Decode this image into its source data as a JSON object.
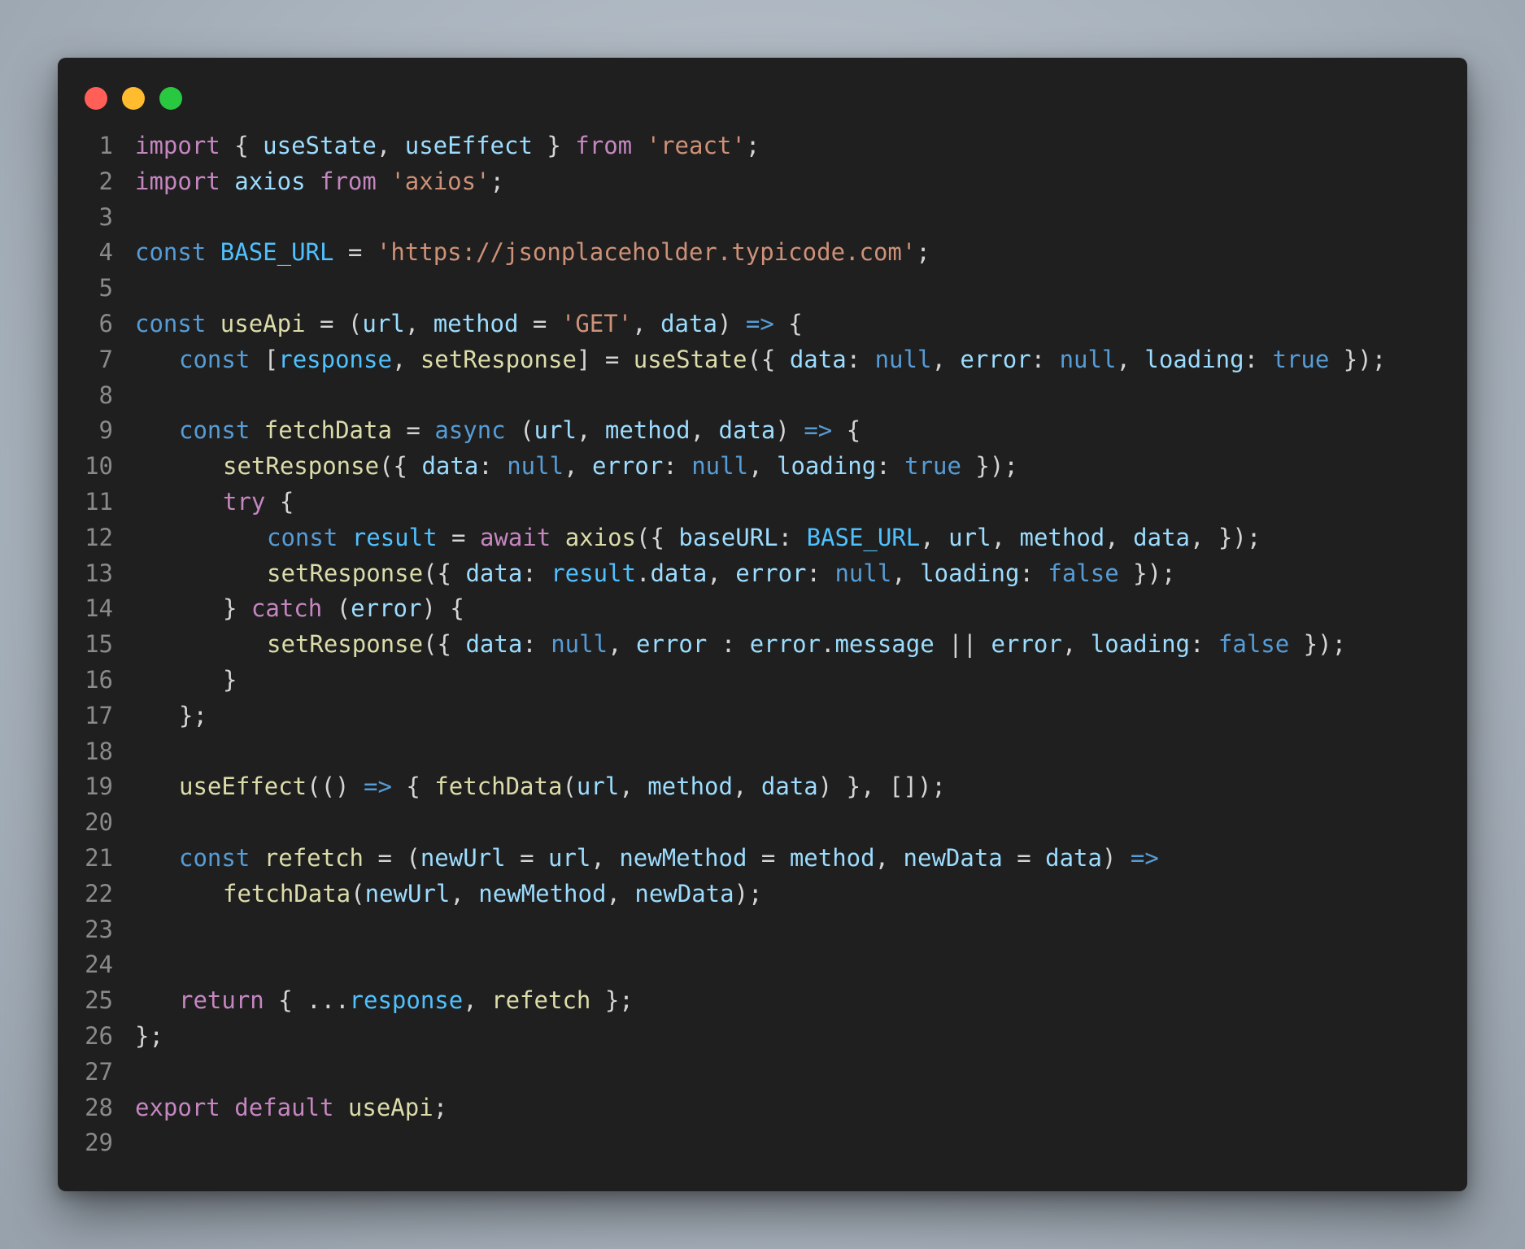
{
  "window": {
    "buttons": {
      "close": "#ff5f57",
      "minimize": "#febc2e",
      "zoom": "#28c840"
    }
  },
  "theme": {
    "background": "#1f1f1f",
    "line_number": "#8a8a8a",
    "colors": {
      "k": "#c586c0",
      "s": "#ce9178",
      "d": "#569cd6",
      "f": "#dcdcaa",
      "v": "#9cdcfe",
      "c": "#4fc1ff",
      "p": "#d4d4d4"
    }
  },
  "code": {
    "language": "javascript",
    "lines": [
      {
        "n": "1",
        "indent": 0,
        "tokens": [
          [
            "k",
            "import"
          ],
          [
            "p",
            " { "
          ],
          [
            "v",
            "useState"
          ],
          [
            "p",
            ", "
          ],
          [
            "v",
            "useEffect"
          ],
          [
            "p",
            " } "
          ],
          [
            "k",
            "from"
          ],
          [
            "p",
            " "
          ],
          [
            "s",
            "'react'"
          ],
          [
            "p",
            ";"
          ]
        ]
      },
      {
        "n": "2",
        "indent": 0,
        "tokens": [
          [
            "k",
            "import"
          ],
          [
            "p",
            " "
          ],
          [
            "v",
            "axios"
          ],
          [
            "p",
            " "
          ],
          [
            "k",
            "from"
          ],
          [
            "p",
            " "
          ],
          [
            "s",
            "'axios'"
          ],
          [
            "p",
            ";"
          ]
        ]
      },
      {
        "n": "3",
        "indent": 0,
        "tokens": []
      },
      {
        "n": "4",
        "indent": 0,
        "tokens": [
          [
            "d",
            "const"
          ],
          [
            "p",
            " "
          ],
          [
            "c",
            "BASE_URL"
          ],
          [
            "p",
            " = "
          ],
          [
            "s",
            "'https://jsonplaceholder.typicode.com'"
          ],
          [
            "p",
            ";"
          ]
        ]
      },
      {
        "n": "5",
        "indent": 0,
        "tokens": []
      },
      {
        "n": "6",
        "indent": 0,
        "tokens": [
          [
            "d",
            "const"
          ],
          [
            "p",
            " "
          ],
          [
            "f",
            "useApi"
          ],
          [
            "p",
            " = ("
          ],
          [
            "v",
            "url"
          ],
          [
            "p",
            ", "
          ],
          [
            "v",
            "method"
          ],
          [
            "p",
            " = "
          ],
          [
            "s",
            "'GET'"
          ],
          [
            "p",
            ", "
          ],
          [
            "v",
            "data"
          ],
          [
            "p",
            ") "
          ],
          [
            "d",
            "=>"
          ],
          [
            "p",
            " {"
          ]
        ]
      },
      {
        "n": "7",
        "indent": 1,
        "tokens": [
          [
            "d",
            "const"
          ],
          [
            "p",
            " ["
          ],
          [
            "c",
            "response"
          ],
          [
            "p",
            ", "
          ],
          [
            "f",
            "setResponse"
          ],
          [
            "p",
            "] = "
          ],
          [
            "f",
            "useState"
          ],
          [
            "p",
            "({ "
          ],
          [
            "v",
            "data"
          ],
          [
            "p",
            ": "
          ],
          [
            "d",
            "null"
          ],
          [
            "p",
            ", "
          ],
          [
            "v",
            "error"
          ],
          [
            "p",
            ": "
          ],
          [
            "d",
            "null"
          ],
          [
            "p",
            ", "
          ],
          [
            "v",
            "loading"
          ],
          [
            "p",
            ": "
          ],
          [
            "d",
            "true"
          ],
          [
            "p",
            " });"
          ]
        ]
      },
      {
        "n": "8",
        "indent": 0,
        "tokens": []
      },
      {
        "n": "9",
        "indent": 1,
        "tokens": [
          [
            "d",
            "const"
          ],
          [
            "p",
            " "
          ],
          [
            "f",
            "fetchData"
          ],
          [
            "p",
            " = "
          ],
          [
            "d",
            "async"
          ],
          [
            "p",
            " ("
          ],
          [
            "v",
            "url"
          ],
          [
            "p",
            ", "
          ],
          [
            "v",
            "method"
          ],
          [
            "p",
            ", "
          ],
          [
            "v",
            "data"
          ],
          [
            "p",
            ") "
          ],
          [
            "d",
            "=>"
          ],
          [
            "p",
            " {"
          ]
        ]
      },
      {
        "n": "10",
        "indent": 2,
        "tokens": [
          [
            "f",
            "setResponse"
          ],
          [
            "p",
            "({ "
          ],
          [
            "v",
            "data"
          ],
          [
            "p",
            ": "
          ],
          [
            "d",
            "null"
          ],
          [
            "p",
            ", "
          ],
          [
            "v",
            "error"
          ],
          [
            "p",
            ": "
          ],
          [
            "d",
            "null"
          ],
          [
            "p",
            ", "
          ],
          [
            "v",
            "loading"
          ],
          [
            "p",
            ": "
          ],
          [
            "d",
            "true"
          ],
          [
            "p",
            " });"
          ]
        ]
      },
      {
        "n": "11",
        "indent": 2,
        "tokens": [
          [
            "k",
            "try"
          ],
          [
            "p",
            " {"
          ]
        ]
      },
      {
        "n": "12",
        "indent": 3,
        "tokens": [
          [
            "d",
            "const"
          ],
          [
            "p",
            " "
          ],
          [
            "c",
            "result"
          ],
          [
            "p",
            " = "
          ],
          [
            "k",
            "await"
          ],
          [
            "p",
            " "
          ],
          [
            "f",
            "axios"
          ],
          [
            "p",
            "({ "
          ],
          [
            "v",
            "baseURL"
          ],
          [
            "p",
            ": "
          ],
          [
            "c",
            "BASE_URL"
          ],
          [
            "p",
            ", "
          ],
          [
            "v",
            "url"
          ],
          [
            "p",
            ", "
          ],
          [
            "v",
            "method"
          ],
          [
            "p",
            ", "
          ],
          [
            "v",
            "data"
          ],
          [
            "p",
            ", });"
          ]
        ]
      },
      {
        "n": "13",
        "indent": 3,
        "tokens": [
          [
            "f",
            "setResponse"
          ],
          [
            "p",
            "({ "
          ],
          [
            "v",
            "data"
          ],
          [
            "p",
            ": "
          ],
          [
            "c",
            "result"
          ],
          [
            "p",
            "."
          ],
          [
            "v",
            "data"
          ],
          [
            "p",
            ", "
          ],
          [
            "v",
            "error"
          ],
          [
            "p",
            ": "
          ],
          [
            "d",
            "null"
          ],
          [
            "p",
            ", "
          ],
          [
            "v",
            "loading"
          ],
          [
            "p",
            ": "
          ],
          [
            "d",
            "false"
          ],
          [
            "p",
            " });"
          ]
        ]
      },
      {
        "n": "14",
        "indent": 2,
        "tokens": [
          [
            "p",
            "} "
          ],
          [
            "k",
            "catch"
          ],
          [
            "p",
            " ("
          ],
          [
            "v",
            "error"
          ],
          [
            "p",
            ") {"
          ]
        ]
      },
      {
        "n": "15",
        "indent": 3,
        "tokens": [
          [
            "f",
            "setResponse"
          ],
          [
            "p",
            "({ "
          ],
          [
            "v",
            "data"
          ],
          [
            "p",
            ": "
          ],
          [
            "d",
            "null"
          ],
          [
            "p",
            ", "
          ],
          [
            "v",
            "error"
          ],
          [
            "p",
            " : "
          ],
          [
            "v",
            "error"
          ],
          [
            "p",
            "."
          ],
          [
            "v",
            "message"
          ],
          [
            "p",
            " || "
          ],
          [
            "v",
            "error"
          ],
          [
            "p",
            ", "
          ],
          [
            "v",
            "loading"
          ],
          [
            "p",
            ": "
          ],
          [
            "d",
            "false"
          ],
          [
            "p",
            " });"
          ]
        ]
      },
      {
        "n": "16",
        "indent": 2,
        "tokens": [
          [
            "p",
            "}"
          ]
        ]
      },
      {
        "n": "17",
        "indent": 1,
        "tokens": [
          [
            "p",
            "};"
          ]
        ]
      },
      {
        "n": "18",
        "indent": 0,
        "tokens": []
      },
      {
        "n": "19",
        "indent": 1,
        "tokens": [
          [
            "f",
            "useEffect"
          ],
          [
            "p",
            "(() "
          ],
          [
            "d",
            "=>"
          ],
          [
            "p",
            " { "
          ],
          [
            "f",
            "fetchData"
          ],
          [
            "p",
            "("
          ],
          [
            "v",
            "url"
          ],
          [
            "p",
            ", "
          ],
          [
            "v",
            "method"
          ],
          [
            "p",
            ", "
          ],
          [
            "v",
            "data"
          ],
          [
            "p",
            ") }, []);"
          ]
        ]
      },
      {
        "n": "20",
        "indent": 0,
        "tokens": []
      },
      {
        "n": "21",
        "indent": 1,
        "tokens": [
          [
            "d",
            "const"
          ],
          [
            "p",
            " "
          ],
          [
            "f",
            "refetch"
          ],
          [
            "p",
            " = ("
          ],
          [
            "v",
            "newUrl"
          ],
          [
            "p",
            " = "
          ],
          [
            "v",
            "url"
          ],
          [
            "p",
            ", "
          ],
          [
            "v",
            "newMethod"
          ],
          [
            "p",
            " = "
          ],
          [
            "v",
            "method"
          ],
          [
            "p",
            ", "
          ],
          [
            "v",
            "newData"
          ],
          [
            "p",
            " = "
          ],
          [
            "v",
            "data"
          ],
          [
            "p",
            ") "
          ],
          [
            "d",
            "=>"
          ]
        ]
      },
      {
        "n": "22",
        "indent": 2,
        "tokens": [
          [
            "f",
            "fetchData"
          ],
          [
            "p",
            "("
          ],
          [
            "v",
            "newUrl"
          ],
          [
            "p",
            ", "
          ],
          [
            "v",
            "newMethod"
          ],
          [
            "p",
            ", "
          ],
          [
            "v",
            "newData"
          ],
          [
            "p",
            ");"
          ]
        ]
      },
      {
        "n": "23",
        "indent": 0,
        "tokens": []
      },
      {
        "n": "24",
        "indent": 0,
        "tokens": []
      },
      {
        "n": "25",
        "indent": 1,
        "tokens": [
          [
            "k",
            "return"
          ],
          [
            "p",
            " { ..."
          ],
          [
            "c",
            "response"
          ],
          [
            "p",
            ", "
          ],
          [
            "f",
            "refetch"
          ],
          [
            "p",
            " };"
          ]
        ]
      },
      {
        "n": "26",
        "indent": 0,
        "tokens": [
          [
            "p",
            "};"
          ]
        ]
      },
      {
        "n": "27",
        "indent": 0,
        "tokens": []
      },
      {
        "n": "28",
        "indent": 0,
        "tokens": [
          [
            "k",
            "export"
          ],
          [
            "p",
            " "
          ],
          [
            "k",
            "default"
          ],
          [
            "p",
            " "
          ],
          [
            "f",
            "useApi"
          ],
          [
            "p",
            ";"
          ]
        ]
      },
      {
        "n": "29",
        "indent": 0,
        "tokens": []
      }
    ]
  }
}
